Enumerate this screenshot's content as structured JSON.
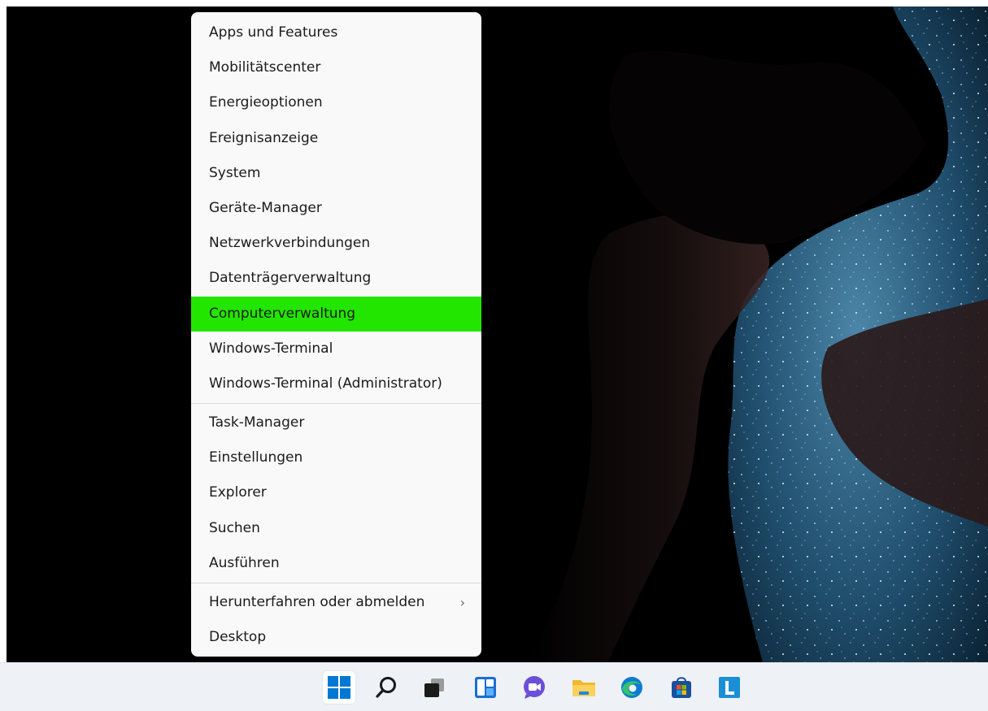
{
  "menu": {
    "items_group1": [
      {
        "label": "Apps und Features"
      },
      {
        "label": "Mobilitätscenter"
      },
      {
        "label": "Energieoptionen"
      },
      {
        "label": "Ereignisanzeige"
      },
      {
        "label": "System"
      },
      {
        "label": "Geräte-Manager"
      },
      {
        "label": "Netzwerkverbindungen"
      },
      {
        "label": "Datenträgerverwaltung"
      },
      {
        "label": "Computerverwaltung",
        "highlighted": true
      },
      {
        "label": "Windows-Terminal"
      },
      {
        "label": "Windows-Terminal (Administrator)"
      }
    ],
    "items_group2": [
      {
        "label": "Task-Manager"
      },
      {
        "label": "Einstellungen"
      },
      {
        "label": "Explorer"
      },
      {
        "label": "Suchen"
      },
      {
        "label": "Ausführen"
      }
    ],
    "items_group3": [
      {
        "label": "Herunterfahren oder abmelden",
        "submenu": true,
        "chevron": "›"
      },
      {
        "label": "Desktop"
      }
    ],
    "highlight_color": "#23e600"
  },
  "taskbar": {
    "icons": [
      {
        "name": "windows-start-icon",
        "active": true
      },
      {
        "name": "search-icon"
      },
      {
        "name": "task-view-icon"
      },
      {
        "name": "widgets-icon"
      },
      {
        "name": "teams-chat-icon"
      },
      {
        "name": "file-explorer-icon"
      },
      {
        "name": "edge-browser-icon"
      },
      {
        "name": "microsoft-store-icon"
      },
      {
        "name": "app-l-icon"
      }
    ]
  }
}
